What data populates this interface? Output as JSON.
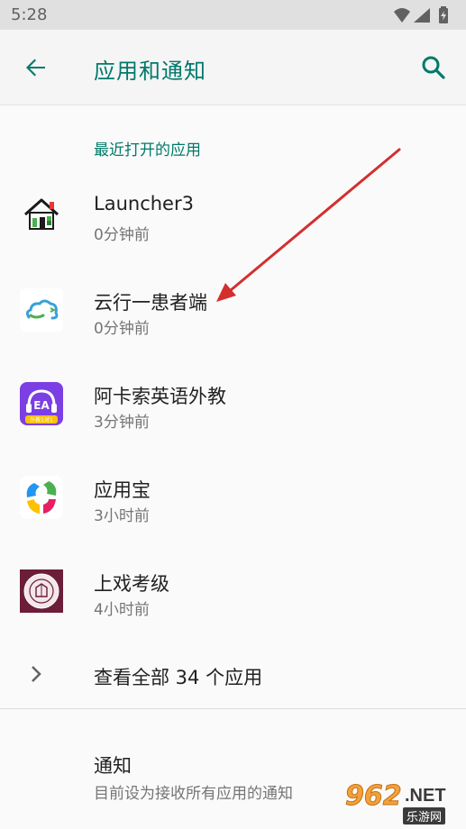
{
  "status_bar": {
    "time": "5:28",
    "icons": [
      "wifi-icon",
      "signal-icon",
      "battery-icon"
    ]
  },
  "app_bar": {
    "title": "应用和通知",
    "back_icon": "arrow-back-icon",
    "search_icon": "search-icon",
    "accent_color": "#00796b"
  },
  "recent_section": {
    "header": "最近打开的应用",
    "apps": [
      {
        "name": "Launcher3",
        "time": "0分钟前",
        "icon": "launcher-house-icon"
      },
      {
        "name": "云行一患者端",
        "time": "0分钟前",
        "icon": "cloud-app-icon"
      },
      {
        "name": "阿卡索英语外教",
        "time": "3分钟前",
        "icon": "acadsoc-app-icon",
        "icon_text": "EA",
        "icon_subtext": "外教1对1"
      },
      {
        "name": "应用宝",
        "time": "3小时前",
        "icon": "yingyongbao-app-icon"
      },
      {
        "name": "上戏考级",
        "time": "4小时前",
        "icon": "seal-app-icon"
      }
    ]
  },
  "see_all": {
    "label": "查看全部 34 个应用",
    "icon": "chevron-right-icon"
  },
  "notifications": {
    "title": "通知",
    "subtitle": "目前设为接收所有应用的通知"
  },
  "watermark": {
    "number": "962",
    "suffix": ".NET",
    "site": "乐游网"
  }
}
